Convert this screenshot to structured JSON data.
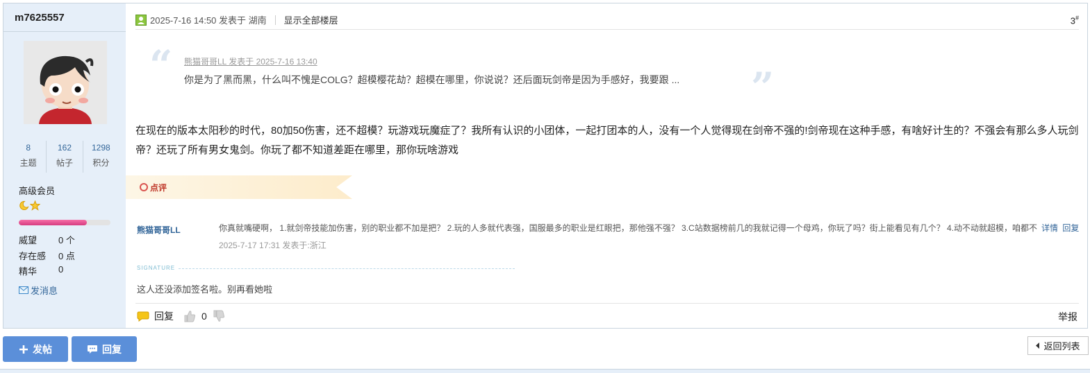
{
  "colors": {
    "accent": "#5b8fd9",
    "link": "#336699",
    "sidebar_bg": "#e6eff9",
    "comment_accent": "#c0392b"
  },
  "user": {
    "name": "m7625557",
    "stats": [
      {
        "value": "8",
        "label": "主题"
      },
      {
        "value": "162",
        "label": "帖子"
      },
      {
        "value": "1298",
        "label": "积分"
      }
    ],
    "grade": "高级会员",
    "level_progress": 0.74,
    "attrs": [
      {
        "label": "威望",
        "value": "0 个"
      },
      {
        "label": "存在感",
        "value": "0 点"
      },
      {
        "label": "精华",
        "value": "0"
      }
    ],
    "send_message": "发消息"
  },
  "post": {
    "meta_time": "2025-7-16 14:50 发表于 湖南",
    "show_all": "显示全部楼层",
    "floor": "3",
    "floor_sup": "#",
    "quote": {
      "author_line": "熊猫哥哥LL 发表于 2025-7-16 13:40",
      "text": "你是为了黑而黑，什么叫不愧是COLG？超模樱花劫？超模在哪里，你说说？还后面玩剑帝是因为手感好，我要跟 ..."
    },
    "body": "在现在的版本太阳秒的时代，80加50伤害，还不超模？玩游戏玩魔症了？我所有认识的小团体，一起打团本的人，没有一个人觉得现在剑帝不强的!剑帝现在这种手感，有啥好计生的？不强会有那么多人玩剑帝？还玩了所有男女鬼剑。你玩了都不知道差距在哪里，那你玩啥游戏",
    "comment_tag": "点评",
    "comment": {
      "author": "熊猫哥哥LL",
      "text": "你真就嘴硬啊， 1.就剑帝技能加伤害，别的职业都不加是把？ 2.玩的人多就代表强，国服最多的职业是红眼把，那他强不强？ 3.C站数据榜前几的我就记得一个母鸡，你玩了吗？街上能看见有几个？ 4.动不动就超模，咱都不",
      "detail": "详情",
      "reply": "回复",
      "time": "2025-7-17 17:31 发表于:浙江"
    },
    "signature_label": "SIGNATURE",
    "signature": "这人还没添加签名啦。别再看她啦",
    "reply_label": "回复",
    "likes": "0",
    "report": "举报"
  },
  "actions": {
    "new_post": "发帖",
    "reply": "回复",
    "back": "返回列表"
  },
  "icons": [
    "user-icon",
    "thumb-up-icon",
    "thumb-down-icon",
    "envelope-icon",
    "moon-icon",
    "star-icon",
    "plus-icon",
    "chat-icon",
    "left-arrow-icon"
  ]
}
